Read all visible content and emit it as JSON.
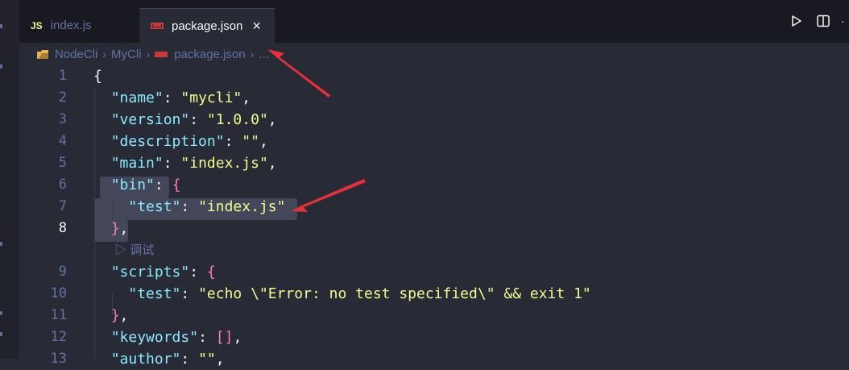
{
  "tabs": [
    {
      "icon": "JS",
      "label": "index.js",
      "active": false
    },
    {
      "icon": "npm-icon",
      "label": "package.json",
      "active": true,
      "close": "×"
    }
  ],
  "actions": {
    "more": "·"
  },
  "breadcrumb": {
    "items": [
      "NodeCli",
      "MyCli",
      "package.json"
    ],
    "sep": "›",
    "ellipsis": "..."
  },
  "codelens": "▷ 调试",
  "lines": [
    {
      "num": "1",
      "tokens": [
        [
          "p",
          "{"
        ]
      ]
    },
    {
      "num": "2",
      "tokens": [
        [
          "p",
          "  "
        ],
        [
          "k",
          "\"name\""
        ],
        [
          "p",
          ": "
        ],
        [
          "s",
          "\"mycli\""
        ],
        [
          "p",
          ","
        ]
      ]
    },
    {
      "num": "3",
      "tokens": [
        [
          "p",
          "  "
        ],
        [
          "k",
          "\"version\""
        ],
        [
          "p",
          ": "
        ],
        [
          "s",
          "\"1.0.0\""
        ],
        [
          "p",
          ","
        ]
      ]
    },
    {
      "num": "4",
      "tokens": [
        [
          "p",
          "  "
        ],
        [
          "k",
          "\"description\""
        ],
        [
          "p",
          ": "
        ],
        [
          "s",
          "\"\""
        ],
        [
          "p",
          ","
        ]
      ]
    },
    {
      "num": "5",
      "tokens": [
        [
          "p",
          "  "
        ],
        [
          "k",
          "\"main\""
        ],
        [
          "p",
          ": "
        ],
        [
          "s",
          "\"index.js\""
        ],
        [
          "p",
          ","
        ]
      ]
    },
    {
      "num": "6",
      "tokens": [
        [
          "p",
          "  "
        ],
        [
          "k",
          "\"bin\""
        ],
        [
          "p",
          ": "
        ],
        [
          "b",
          "{"
        ]
      ]
    },
    {
      "num": "7",
      "tokens": [
        [
          "p",
          "    "
        ],
        [
          "k",
          "\"test\""
        ],
        [
          "p",
          ": "
        ],
        [
          "s",
          "\"index.js\""
        ]
      ]
    },
    {
      "num": "8",
      "tokens": [
        [
          "p",
          "  "
        ],
        [
          "b",
          "}"
        ],
        [
          "p",
          ","
        ]
      ],
      "active": true
    },
    {
      "num": "9",
      "tokens": [
        [
          "p",
          "  "
        ],
        [
          "k",
          "\"scripts\""
        ],
        [
          "p",
          ": "
        ],
        [
          "b",
          "{"
        ]
      ]
    },
    {
      "num": "10",
      "tokens": [
        [
          "p",
          "    "
        ],
        [
          "k",
          "\"test\""
        ],
        [
          "p",
          ": "
        ],
        [
          "s",
          "\"echo \\\"Error: no test specified\\\" && exit 1\""
        ]
      ]
    },
    {
      "num": "11",
      "tokens": [
        [
          "p",
          "  "
        ],
        [
          "b",
          "}"
        ],
        [
          "p",
          ","
        ]
      ]
    },
    {
      "num": "12",
      "tokens": [
        [
          "p",
          "  "
        ],
        [
          "k",
          "\"keywords\""
        ],
        [
          "p",
          ": "
        ],
        [
          "b",
          "[]"
        ],
        [
          "p",
          ","
        ]
      ]
    },
    {
      "num": "13",
      "tokens": [
        [
          "p",
          "  "
        ],
        [
          "k",
          "\"author\""
        ],
        [
          "p",
          ": "
        ],
        [
          "s",
          "\"\""
        ],
        [
          "p",
          ","
        ]
      ]
    }
  ],
  "colors": {
    "bg": "#282a36",
    "key": "#8be9fd",
    "string": "#f1fa8c",
    "bracket": "#ff79c6",
    "arrow": "#e8303a"
  }
}
